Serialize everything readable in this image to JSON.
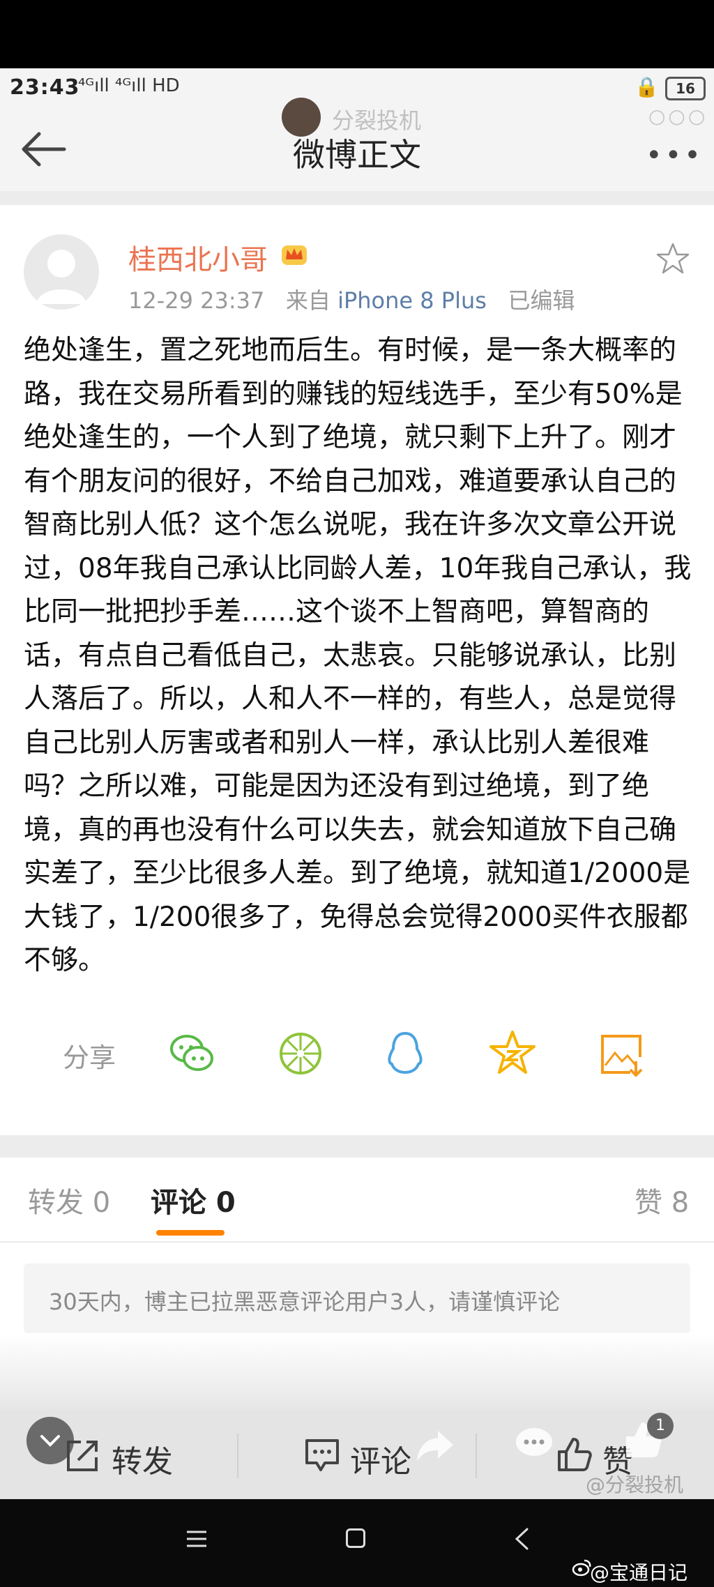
{
  "status_bar": {
    "time": "23:43",
    "signal": "⁴ᴳıll ⁴ᴳıll HD",
    "battery": "16"
  },
  "nav": {
    "title": "微博正文"
  },
  "watermark": {
    "top_text": "分裂投机",
    "bottom_text": "@分裂投机"
  },
  "post": {
    "author": "桂西北小哥",
    "timestamp": "12-29 23:37",
    "source_prefix": "来自",
    "device": "iPhone 8 Plus",
    "edited": "已编辑",
    "body": "绝处逢生，置之死地而后生。有时候，是一条大概率的路，我在交易所看到的赚钱的短线选手，至少有50%是绝处逢生的，一个人到了绝境，就只剩下上升了。刚才有个朋友问的很好，不给自己加戏，难道要承认自己的智商比别人低？这个怎么说呢，我在许多次文章公开说过，08年我自己承认比同龄人差，10年我自己承认，我比同一批把抄手差……这个谈不上智商吧，算智商的话，有点自己看低自己，太悲哀。只能够说承认，比别人落后了。所以，人和人不一样的，有些人，总是觉得自己比别人厉害或者和别人一样，承认比别人差很难吗？之所以难，可能是因为还没有到过绝境，到了绝境，真的再也没有什么可以失去，就会知道放下自己确实差了，至少比很多人差。到了绝境，就知道1/2000是大钱了，1/200很多了，免得总会觉得2000买件衣服都不够。"
  },
  "share": {
    "label": "分享",
    "icons": [
      "wechat-icon",
      "moments-icon",
      "qq-icon",
      "qzone-icon",
      "save-image-icon"
    ]
  },
  "tabs": {
    "repost": "转发 0",
    "comment": "评论 0",
    "like": "赞 8"
  },
  "notice": "30天内，博主已拉黑恶意评论用户3人，请谨慎评论",
  "actions": {
    "repost": "转发",
    "comment": "评论",
    "like": "赞",
    "badge": "1"
  },
  "credit": "@宝通日记",
  "colors": {
    "username": "#eb7350",
    "device_link": "#5d7ea8",
    "tab_underline": "#ff8200",
    "share_green": "#58b947",
    "share_blue": "#4aa3e0",
    "share_yellow": "#f5b300",
    "share_orange": "#f59a1b"
  }
}
